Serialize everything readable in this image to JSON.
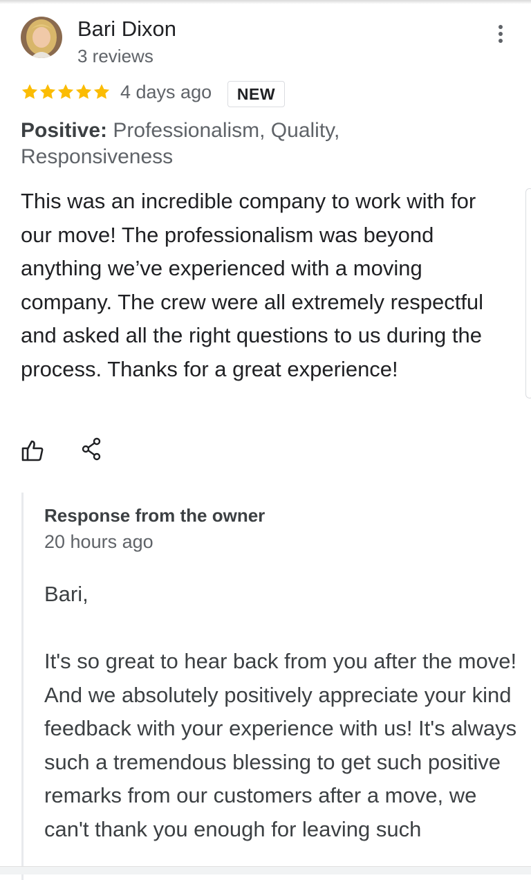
{
  "reviewer": {
    "name": "Bari Dixon",
    "review_count": "3 reviews"
  },
  "review": {
    "rating": 5,
    "rating_max": 5,
    "star_color": "#fbbc04",
    "time": "4 days ago",
    "badge": "NEW",
    "positive_label": "Positive:",
    "positive_value": "Professionalism, Quality,  Responsiveness",
    "text": "This was an incredible company to work with for our move! The professionalism was beyond anything we’ve experienced with a moving company. The crew were all extremely respectful and asked all the right questions to us during the process. Thanks for a great experience!"
  },
  "actions": {
    "like_icon": "thumbs-up-icon",
    "share_icon": "share-icon",
    "more_icon": "more-vert-icon"
  },
  "owner_response": {
    "title": "Response from the owner",
    "time": "20 hours ago",
    "greeting": "Bari,",
    "text": "It's so great to hear back from you after the move! And we absolutely positively appreciate your kind feedback with your experience with us! It's always such a tremendous blessing to get such positive remarks from our customers after a move, we can't thank you enough for leaving such"
  }
}
